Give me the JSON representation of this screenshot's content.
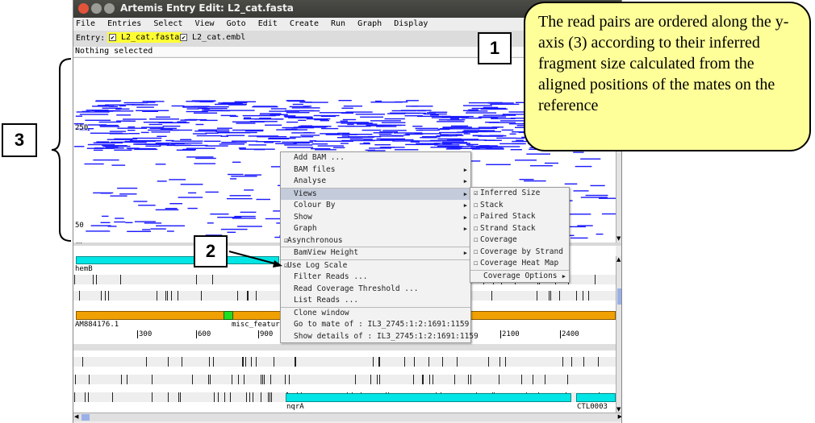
{
  "window": {
    "title": "Artemis Entry Edit: L2_cat.fasta"
  },
  "menubar": [
    "File",
    "Entries",
    "Select",
    "View",
    "Goto",
    "Edit",
    "Create",
    "Run",
    "Graph",
    "Display"
  ],
  "entry_bar": {
    "label": "Entry:",
    "entries": [
      "L2_cat.fasta",
      "L2_cat.embl"
    ]
  },
  "status": "Nothing selected",
  "bam_view": {
    "y_labels": [
      "250",
      "50"
    ]
  },
  "context_menu": {
    "items": [
      "Add BAM ...",
      "BAM files",
      "Analyse",
      "Views",
      "Colour By",
      "Show",
      "Graph",
      "Asynchronous",
      "BamView Height",
      "Use Log Scale",
      "Filter Reads ...",
      "Read Coverage Threshold ...",
      "List Reads ...",
      "Clone window",
      "Go to mate of : IL3_2745:1:2:1691:1159",
      "Show details of : IL3_2745:1:2:1691:1159"
    ]
  },
  "views_submenu": {
    "items": [
      "Inferred Size",
      "Stack",
      "Paired Stack",
      "Strand Stack",
      "Coverage",
      "Coverage by Strand",
      "Coverage Heat Map",
      "Coverage Options"
    ]
  },
  "feature_view": {
    "labels": {
      "hemB": "hemB",
      "accession": "AM884176.1",
      "misc": "misc_feature",
      "nqrA": "nqrA",
      "ctl": "CTL0003"
    },
    "ruler": [
      "300",
      "600",
      "900",
      "2100",
      "2400"
    ]
  },
  "annotations": {
    "label1": "1",
    "label2": "2",
    "label3": "3",
    "note_text": "The read pairs are ordered along the y-axis (3) according to their inferred fragment size calculated from the aligned positions of the mates on the reference"
  },
  "colors": {
    "reads": "#1a1aff",
    "cyan_feature": "#00e5e5",
    "orange_feature": "#f0a000",
    "note_bg": "#ffff99"
  }
}
